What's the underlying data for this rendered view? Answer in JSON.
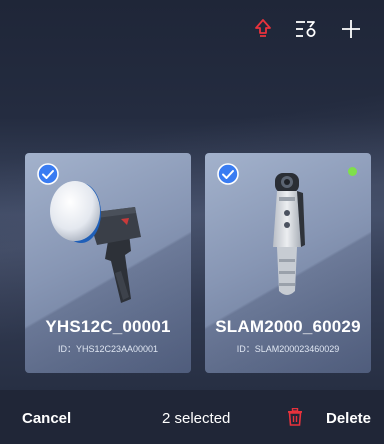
{
  "header": {
    "upload_icon": "upload-arrow-icon",
    "filter_icon": "filter-sort-icon",
    "add_icon": "plus-icon",
    "accent_color": "#e8323c"
  },
  "devices": [
    {
      "name": "YHS12C_00001",
      "id_label": "ID：YHS12C23AA00001",
      "selected": true,
      "online": false
    },
    {
      "name": "SLAM2000_60029",
      "id_label": "ID：SLAM200023460029",
      "selected": true,
      "online": true,
      "status_color": "#7fe04a"
    }
  ],
  "footer": {
    "cancel_label": "Cancel",
    "selected_label": "2 selected",
    "delete_label": "Delete",
    "trash_icon": "trash-icon"
  }
}
